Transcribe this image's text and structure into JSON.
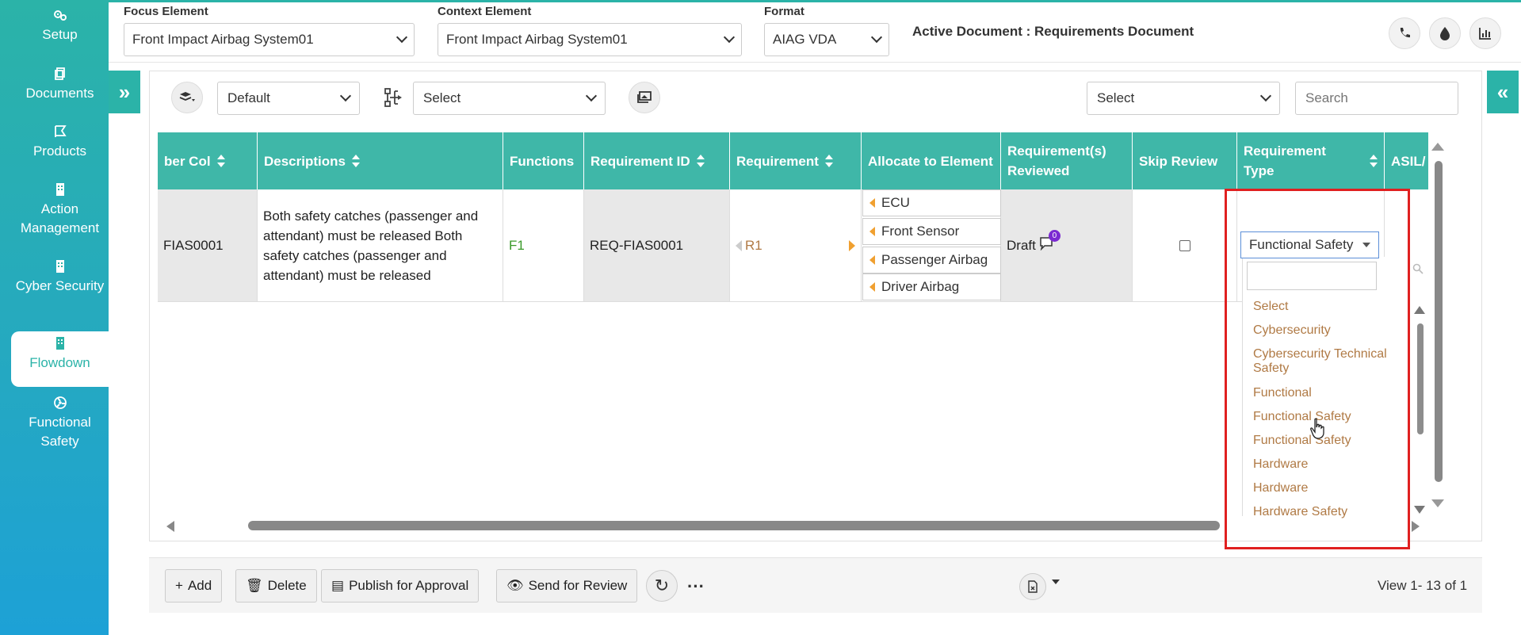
{
  "sidebar": {
    "items": [
      {
        "label": "Setup",
        "icon": "gears-icon"
      },
      {
        "label": "Documents",
        "icon": "documents-icon"
      },
      {
        "label": "Products",
        "icon": "products-icon"
      },
      {
        "label": "Action Management",
        "icon": "building-icon"
      },
      {
        "label": "Cyber Security",
        "icon": "building-icon"
      },
      {
        "label": "Flowdown",
        "icon": "building-icon",
        "active": true
      },
      {
        "label": "Functional Safety",
        "icon": "radiation-icon"
      }
    ]
  },
  "header": {
    "focus_label": "Focus Element",
    "focus_value": "Front Impact Airbag System01",
    "context_label": "Context Element",
    "context_value": "Front Impact Airbag System01",
    "format_label": "Format",
    "format_value": "AIAG VDA",
    "active_document": "Active Document : Requirements Document"
  },
  "toolbar": {
    "layer_select": "Default",
    "hierarchy_select": "Select",
    "right_select": "Select",
    "search_placeholder": "Search"
  },
  "grid": {
    "columns": [
      "ber Col",
      "Descriptions",
      "Functions",
      "Requirement ID",
      "Requirement",
      "Allocate to Element",
      "Requirement(s) Reviewed",
      "Skip Review",
      "Requirement Type",
      "ASIL/"
    ],
    "row": {
      "number_col": "FIAS0001",
      "description": "Both safety catches (passenger and attendant) must be released Both safety catches (passenger and attendant) must be released",
      "function": "F1",
      "requirement_id": "REQ-FIAS0001",
      "requirement": "R1",
      "allocate": [
        "ECU",
        "Front Sensor",
        "Passenger Airbag",
        "Driver Airbag"
      ],
      "reviewed_status": "Draft",
      "comment_count": "0",
      "requirement_type": "Functional Safety"
    }
  },
  "dropdown": {
    "options": [
      "Select",
      "Cybersecurity",
      "Cybersecurity Technical Safety",
      "Functional",
      "Functional Safety",
      "Functional Safety",
      "Hardware",
      "Hardware",
      "Hardware Safety"
    ]
  },
  "footer": {
    "add": "Add",
    "delete": "Delete",
    "publish": "Publish for Approval",
    "send_review": "Send for Review",
    "view_text": "View 1- 13 of 1"
  },
  "colors": {
    "teal": "#3fb7a8",
    "option_text": "#b07a45",
    "highlight_border": "#e02020"
  }
}
